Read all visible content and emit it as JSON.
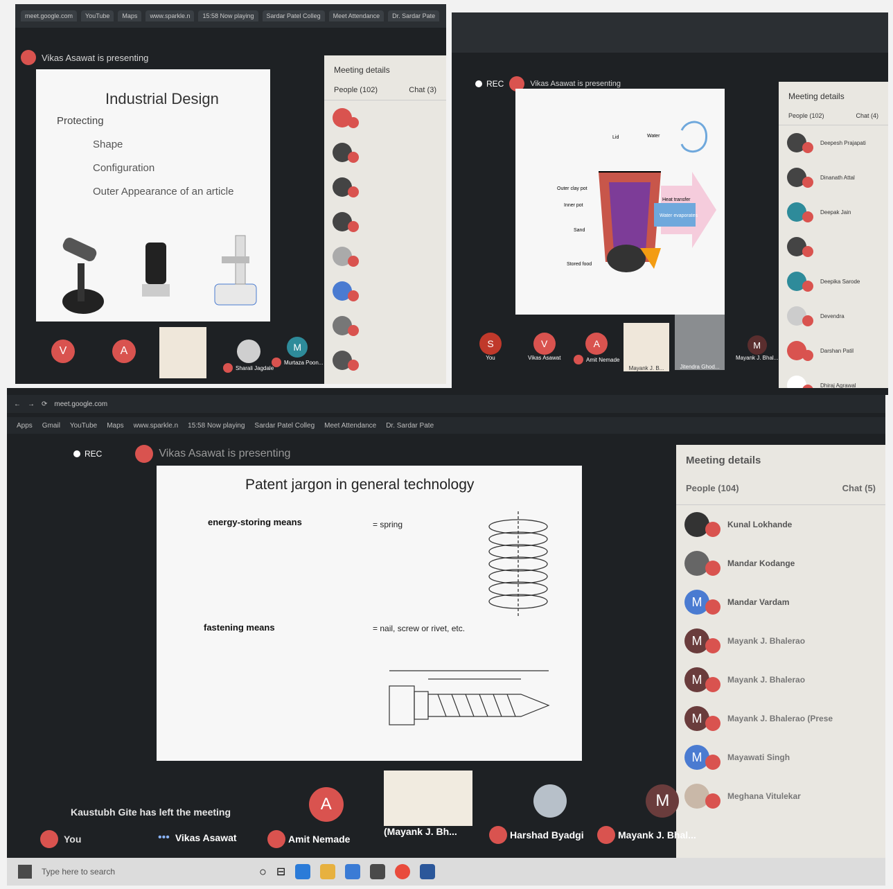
{
  "p1": {
    "tab_title": "meet.google.com",
    "tabs": [
      "YouTube",
      "Maps",
      "www.sparkle.n",
      "15:58 Now playing",
      "Sardar Patel Colleg",
      "Meet Attendance",
      "Dr. Sardar Pate"
    ],
    "presenting": "Vikas Asawat is presenting",
    "slide": {
      "title": "Industrial Design",
      "line1": "Protecting",
      "line2": "Shape",
      "line3": "Configuration",
      "line4": "Outer Appearance of an article"
    },
    "details": {
      "title": "Meeting details",
      "people": "People (102)",
      "chat": "Chat (3)"
    },
    "tiles": [
      {
        "initial": "V",
        "label": ""
      },
      {
        "initial": "A",
        "label": ""
      },
      {
        "initial": "",
        "label": ""
      },
      {
        "initial": "",
        "label": "Sharali Jagdale"
      },
      {
        "initial": "M",
        "label": "Murtaza Poon..."
      }
    ]
  },
  "p2": {
    "presenting": "Vikas Asawat is presenting",
    "rec": "REC",
    "diagram": {
      "l1": "Outer clay pot",
      "l2": "Inner pot",
      "l3": "Sand",
      "l4": "Stored food",
      "l5": "Heat transfer",
      "l6": "Water evaporates",
      "l7": "Water",
      "l8": "Lid"
    },
    "details": {
      "title": "Meeting details",
      "people": "People (102)",
      "chat": "Chat (4)"
    },
    "people": [
      "Deepesh Prajapati",
      "Dinanath Attal",
      "Deepak Jain",
      "",
      "Deepika Sarode",
      "Devendra",
      "Darshan Patil",
      "Dhiraj Agrawal"
    ],
    "tiles": [
      {
        "initial": "S",
        "label": "You"
      },
      {
        "initial": "V",
        "label": "Vikas Asawat"
      },
      {
        "initial": "A",
        "label": "Amit Nemade"
      },
      {
        "initial": "",
        "label": "Mayank J. B..."
      },
      {
        "initial": "",
        "label": "Jitendra Ghod..."
      },
      {
        "initial": "M",
        "label": "Mayank J. Bhal..."
      }
    ]
  },
  "p3": {
    "address": "meet.google.com",
    "bookmarks": [
      "Apps",
      "Gmail",
      "YouTube",
      "Maps",
      "www.sparkle.n",
      "15:58 Now playing",
      "Sardar Patel Colleg",
      "Meet Attendance",
      "Dr. Sardar Pate"
    ],
    "rec": "REC",
    "presenting": "Vikas Asawat is presenting",
    "slide": {
      "title": "Patent jargon in general technology",
      "term1": "energy-storing means",
      "def1": "= spring",
      "term2": "fastening means",
      "def2": "= nail, screw or rivet, etc."
    },
    "details": {
      "title": "Meeting details",
      "people": "People (104)",
      "chat": "Chat (5)",
      "list": [
        {
          "initial": "",
          "name": "Kunal Lokhande"
        },
        {
          "initial": "",
          "name": "Mandar Kodange"
        },
        {
          "initial": "M",
          "name": "Mandar Vardam"
        },
        {
          "initial": "M",
          "name": "Mayank J. Bhalerao"
        },
        {
          "initial": "M",
          "name": "Mayank J. Bhalerao"
        },
        {
          "initial": "M",
          "name": "Mayank J. Bhalerao (Prese"
        },
        {
          "initial": "M",
          "name": "Mayawati Singh"
        },
        {
          "initial": "",
          "name": "Meghana Vitulekar"
        }
      ]
    },
    "notification": "Kaustubh Gite has left the meeting",
    "tiles": [
      {
        "initial": "",
        "label": "You"
      },
      {
        "initial": "",
        "label": "Vikas Asawat"
      },
      {
        "initial": "A",
        "label": "Amit Nemade"
      },
      {
        "initial": "",
        "label": "(Mayank J. Bh..."
      },
      {
        "initial": "",
        "label": "Harshad Byadgi"
      },
      {
        "initial": "M",
        "label": "Mayank J. Bhal..."
      }
    ],
    "taskbar_search": "Type here to search"
  }
}
